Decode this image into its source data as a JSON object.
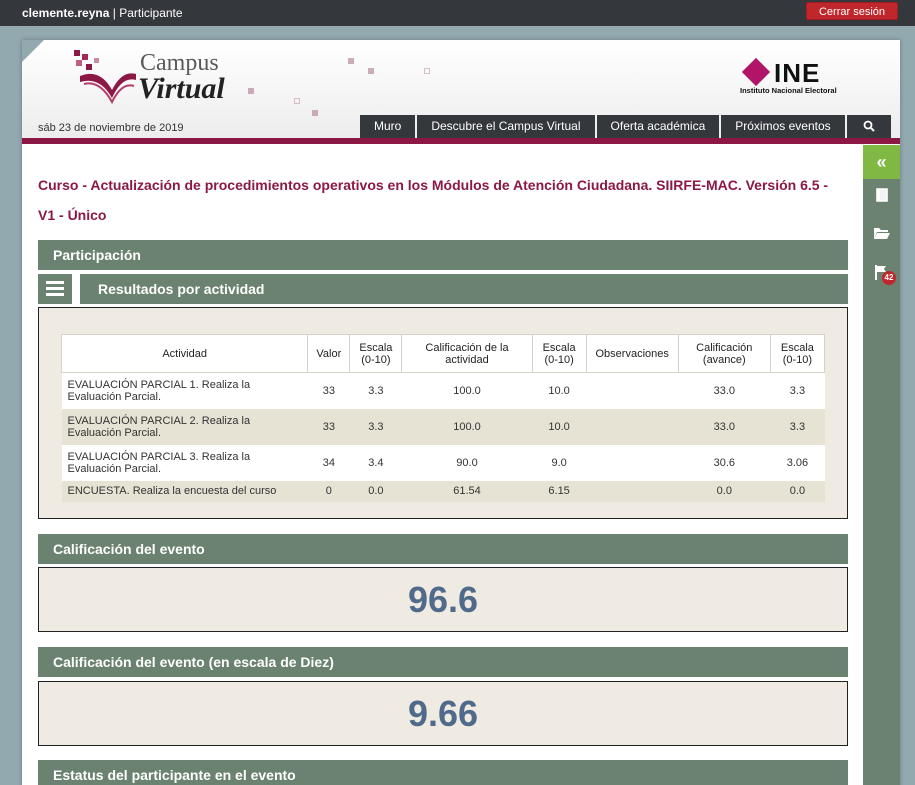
{
  "topbar": {
    "username": "clemente.reyna",
    "role": "Participante",
    "logout_label": "Cerrar sesión"
  },
  "header": {
    "logo_campus": "Campus",
    "logo_virtual": "Virtual",
    "ine_logo": "INE",
    "ine_subtitle": "Instituto Nacional Electoral",
    "date": "sáb 23 de noviembre de 2019",
    "nav": [
      "Muro",
      "Descubre el Campus Virtual",
      "Oferta académica",
      "Próximos eventos"
    ],
    "search_icon": "search-icon"
  },
  "sidebar": {
    "collapse_icon": "double-chevron-left-icon",
    "icons": [
      "book-icon",
      "folder-open-icon",
      "flag-icon"
    ],
    "badge": "42"
  },
  "course_title": "Curso - Actualización de procedimientos operativos en los Módulos de Atención Ciudadana. SIIRFE-MAC. Versión 6.5 - V1 - Único",
  "participation": {
    "title": "Participación",
    "results_title": "Resultados por actividad",
    "columns": [
      "Actividad",
      "Valor",
      "Escala (0-10)",
      "Calificación de la actividad",
      "Escala (0-10)",
      "Observaciones",
      "Calificación (avance)",
      "Escala (0-10)"
    ],
    "rows": [
      [
        "EVALUACIÓN PARCIAL 1. Realiza la Evaluación Parcial.",
        "33",
        "3.3",
        "100.0",
        "10.0",
        "",
        "33.0",
        "3.3"
      ],
      [
        "EVALUACIÓN PARCIAL 2. Realiza la Evaluación Parcial.",
        "33",
        "3.3",
        "100.0",
        "10.0",
        "",
        "33.0",
        "3.3"
      ],
      [
        "EVALUACIÓN PARCIAL 3. Realiza la Evaluación Parcial.",
        "34",
        "3.4",
        "90.0",
        "9.0",
        "",
        "30.6",
        "3.06"
      ],
      [
        "ENCUESTA. Realiza la encuesta del curso",
        "0",
        "0.0",
        "61.54",
        "6.15",
        "",
        "0.0",
        "0.0"
      ]
    ]
  },
  "event_grade": {
    "title": "Calificación del evento",
    "value": "96.6"
  },
  "event_grade_ten": {
    "title": "Calificación del evento (en escala de Diez)",
    "value": "9.66"
  },
  "status": {
    "title": "Estatus del participante en el evento"
  },
  "colors": {
    "accent": "#8c1846",
    "section": "#6b8270",
    "logout": "#c0272d",
    "value": "#4f6a8a"
  }
}
